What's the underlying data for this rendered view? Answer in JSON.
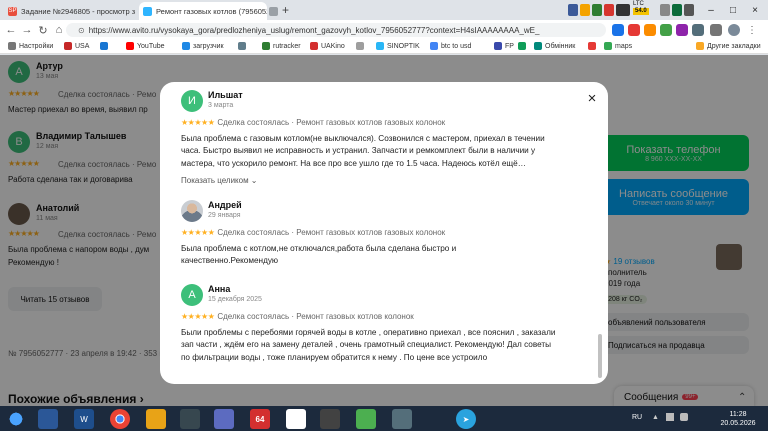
{
  "browser": {
    "tabs": [
      {
        "label": "Задание №2946805 - просмотр з",
        "favicon": "SP"
      },
      {
        "label": "Ремонт газовых котлов (79560527",
        "favicon": ""
      },
      {
        "label": "",
        "favicon": ""
      }
    ],
    "new_tab": "+",
    "url": "https://www.avito.ru/vysokaya_gora/predlozheniya_uslug/remont_gazovyh_kotlov_7956052777?context=H4sIAAAAAAAA_wE_",
    "ext_labels": [
      "LTC",
      "54.0"
    ],
    "bookmarks": [
      "Настройки",
      "USA",
      "",
      "YouTube",
      "загрузчик",
      "",
      "rutracker",
      "UAKino",
      "",
      "SINOPTIK",
      "btc to usd",
      "FP",
      "",
      "Обмінник",
      "",
      "maps"
    ],
    "other_bookmarks": "Другие закладки"
  },
  "background": {
    "reviews": [
      {
        "initial": "А",
        "name": "Артур",
        "date": "13 мая",
        "stars": "★★★★★",
        "meta": "Сделка состоялась · Ремо",
        "text": "Мастер приехал во время, выявил пр"
      },
      {
        "initial": "В",
        "name": "Владимир Талышев",
        "date": "12 мая",
        "stars": "★★★★★",
        "meta": "Сделка состоялась · Ремо",
        "text": "Работа сделана так и договарива"
      },
      {
        "initial": "",
        "name": "Анатолий",
        "date": "11 мая",
        "stars": "★★★★★",
        "meta": "Сделка состоялась · Ремо",
        "text": "Была проблема с напором воды , дум",
        "text2": "Рекомендую !"
      }
    ],
    "read_reviews_button": "Читать 15 отзывов",
    "listing_meta": "№ 7956052777 · 23 апреля в 19:42 · 353 п",
    "similar_heading": "Похожие объявления",
    "show_phone": {
      "title": "Показать телефон",
      "subtitle": "8 960 XXX-XX-XX"
    },
    "write_message": {
      "title": "Написать сообщение",
      "subtitle": "Отвечает около 30 минут"
    },
    "seller_reviews": "19 отзывов",
    "seller_role": "сполнитель",
    "seller_since": "2019 года",
    "co2_badge": "−208 кг CO₂",
    "user_ads": "объявлений пользователя",
    "subscribe": "Подписаться на продавца",
    "messages_label": "Сообщения",
    "messages_badge": "99+"
  },
  "modal": {
    "reviews": [
      {
        "initial": "И",
        "avatar_color": "#3dbf7a",
        "name": "Ильшат",
        "date": "3 марта",
        "stars": "★★★★★",
        "meta": "Сделка состоялась · Ремонт газовых котлов газовых колонок",
        "lines": [
          "Была проблема с газовым котлом(не выключался). Созвонился с мастером, приехал в течении",
          "часа. Быстро выявил не исправность и устранил. Запчасти и ремкомплект были в наличии у",
          "мастера, что ускорило ремонт. На все про все ушло где то 1.5 часа. Надеюсь котёл ещё…"
        ],
        "show_more": "Показать целиком ⌄"
      },
      {
        "initial": "",
        "avatar_color": "",
        "name": "Андрей",
        "date": "29 января",
        "stars": "★★★★★",
        "meta": "Сделка состоялась · Ремонт газовых котлов газовых колонок",
        "lines": [
          "Была проблема с котлом,не отключался,работа была сделана быстро и",
          "качественно.Рекомендую"
        ]
      },
      {
        "initial": "А",
        "avatar_color": "#3dbf7a",
        "name": "Анна",
        "date": "15 декабря 2025",
        "stars": "★★★★★",
        "meta": "Сделка состоялась · Ремонт газовых котлов колонок",
        "lines": [
          "Были проблемы с перебоями горячей воды в котле , оперативно приехал , все пояснил , заказали",
          "зап части , ждём его на замену деталей , очень грамотный специалист. Рекомендую! Дал советы",
          "по фильтрации воды , тоже планируем обратится к нему . По цене все устроило"
        ]
      }
    ],
    "close_icon": "×"
  },
  "taskbar": {
    "lang": "RU",
    "time": "11:28",
    "date": "20.05.2026",
    "icons": [
      "start",
      "file-explorer",
      "shield",
      "chrome",
      "folder",
      "media",
      "paint",
      "64",
      "chart",
      "gamepad",
      "folder-green",
      "computer",
      "telegram"
    ]
  },
  "colors": {
    "accent_green": "#02d15c",
    "accent_blue": "#00aaff",
    "star": "#ffb021",
    "avatar_green": "#3dbf7a"
  }
}
